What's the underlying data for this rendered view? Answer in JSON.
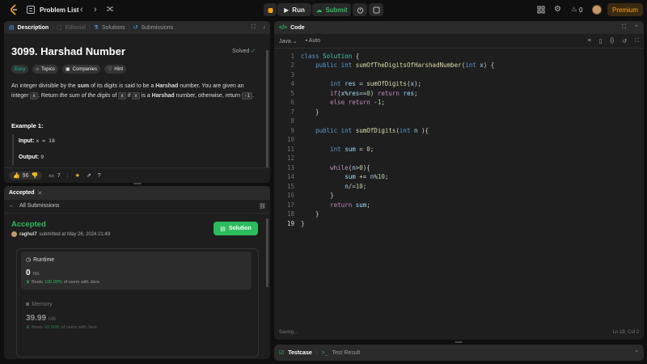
{
  "topbar": {
    "problem_list": "Problem List",
    "run": "Run",
    "submit": "Submit",
    "streak_count": "0",
    "premium": "Premium"
  },
  "description_panel": {
    "tabs": [
      "Description",
      "Editorial",
      "Solutions",
      "Submissions"
    ],
    "title": "3099. Harshad Number",
    "status": "Solved",
    "chips": [
      "Easy",
      "Topics",
      "Companies",
      "Hint"
    ],
    "para": {
      "t1": "An integer divisible by the ",
      "b1": "sum",
      "t2": " of its digits is said to be a ",
      "b2": "Harshad",
      "t3": " number. You are given an",
      "t4": "integer ",
      "c1": "x",
      "t5": ". Return ",
      "i1": "the sum of the digits",
      "t6": " of ",
      "c2": "x",
      "t7": " if ",
      "c3": "x",
      "t8": " is a ",
      "b3": "Harshad",
      "t9": " number, otherwise, return ",
      "c4": "-1",
      "t10": "."
    },
    "example_title": "Example 1:",
    "input_label": "Input:",
    "input_value": "x = 18",
    "output_label": "Output:",
    "output_value": "9",
    "upvotes": "96",
    "comments": "7"
  },
  "accepted_panel": {
    "tab": "Accepted",
    "back": "All Submissions",
    "status": "Accepted",
    "user": "raghul7",
    "submitted": "submitted at May 26, 2024 21:49",
    "solution_button": "Solution",
    "runtime_label": "Runtime",
    "runtime_value": "0",
    "runtime_unit": "ms",
    "runtime_beats_prefix": "Beats",
    "runtime_beats_pct": "100.00%",
    "runtime_beats_suffix": "of users with Java",
    "memory_label": "Memory",
    "memory_value": "39.99",
    "memory_unit": "MB",
    "memory_beats_prefix": "Beats",
    "memory_beats_pct": "92.90%",
    "memory_beats_suffix": "of users with Java"
  },
  "code_panel": {
    "tab": "Code",
    "language": "Java",
    "autosave": "Auto",
    "line_numbers": [
      "1",
      "2",
      "3",
      "4",
      "5",
      "6",
      "7",
      "8",
      "9",
      "10",
      "11",
      "12",
      "13",
      "14",
      "15",
      "16",
      "17",
      "18",
      "19"
    ],
    "status_left": "Saving...",
    "status_right": "Ln 19, Col 2"
  },
  "bottom_panel": {
    "testcase": "Testcase",
    "test_result": "Test Result"
  },
  "colors": {
    "accent_green": "#2cbb5d",
    "accent_orange": "#ffa116",
    "easy_teal": "#00b8a3"
  }
}
